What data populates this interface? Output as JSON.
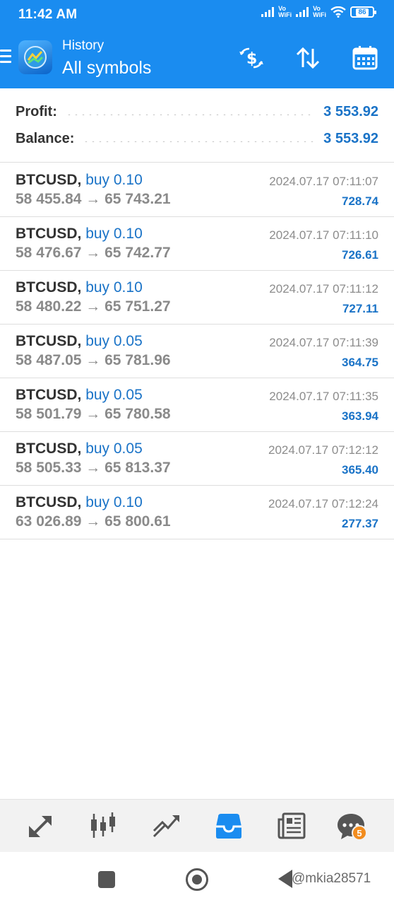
{
  "status_bar": {
    "time": "11:42 AM",
    "volte1": [
      "Vo",
      "WiFi"
    ],
    "volte2": [
      "Vo",
      "WiFi"
    ],
    "battery": "86"
  },
  "header": {
    "subtitle": "History",
    "title": "All symbols",
    "icons": [
      "menu-icon",
      "app-logo",
      "deposit-exchange-icon",
      "sort-icon",
      "calendar-icon"
    ]
  },
  "summary": {
    "profit_label": "Profit:",
    "profit_value": "3 553.92",
    "balance_label": "Balance:",
    "balance_value": "3 553.92"
  },
  "deals": [
    {
      "symbol": "BTCUSD,",
      "type": "buy 0.10",
      "open": "58 455.84",
      "arrow": "→",
      "close": "65 743.21",
      "time": "2024.07.17 07:11:07",
      "profit": "728.74"
    },
    {
      "symbol": "BTCUSD,",
      "type": "buy 0.10",
      "open": "58 476.67",
      "arrow": "→",
      "close": "65 742.77",
      "time": "2024.07.17 07:11:10",
      "profit": "726.61"
    },
    {
      "symbol": "BTCUSD,",
      "type": "buy 0.10",
      "open": "58 480.22",
      "arrow": "→",
      "close": "65 751.27",
      "time": "2024.07.17 07:11:12",
      "profit": "727.11"
    },
    {
      "symbol": "BTCUSD,",
      "type": "buy 0.05",
      "open": "58 487.05",
      "arrow": "→",
      "close": "65 781.96",
      "time": "2024.07.17 07:11:39",
      "profit": "364.75"
    },
    {
      "symbol": "BTCUSD,",
      "type": "buy 0.05",
      "open": "58 501.79",
      "arrow": "→",
      "close": "65 780.58",
      "time": "2024.07.17 07:11:35",
      "profit": "363.94"
    },
    {
      "symbol": "BTCUSD,",
      "type": "buy 0.05",
      "open": "58 505.33",
      "arrow": "→",
      "close": "65 813.37",
      "time": "2024.07.17 07:12:12",
      "profit": "365.40"
    },
    {
      "symbol": "BTCUSD,",
      "type": "buy 0.10",
      "open": "63 026.89",
      "arrow": "→",
      "close": "65 800.61",
      "time": "2024.07.17 07:12:24",
      "profit": "277.37"
    }
  ],
  "toolbar": {
    "items": [
      "quotes-icon",
      "chart-icon",
      "trade-icon",
      "history-icon",
      "news-icon",
      "chat-icon"
    ],
    "active": "history-icon",
    "chat_badge": "5"
  },
  "watermark": "@mkia28571",
  "colors": {
    "header_bg": "#1a8cf0",
    "accent": "#1a73c7",
    "badge": "#f28c1e"
  }
}
